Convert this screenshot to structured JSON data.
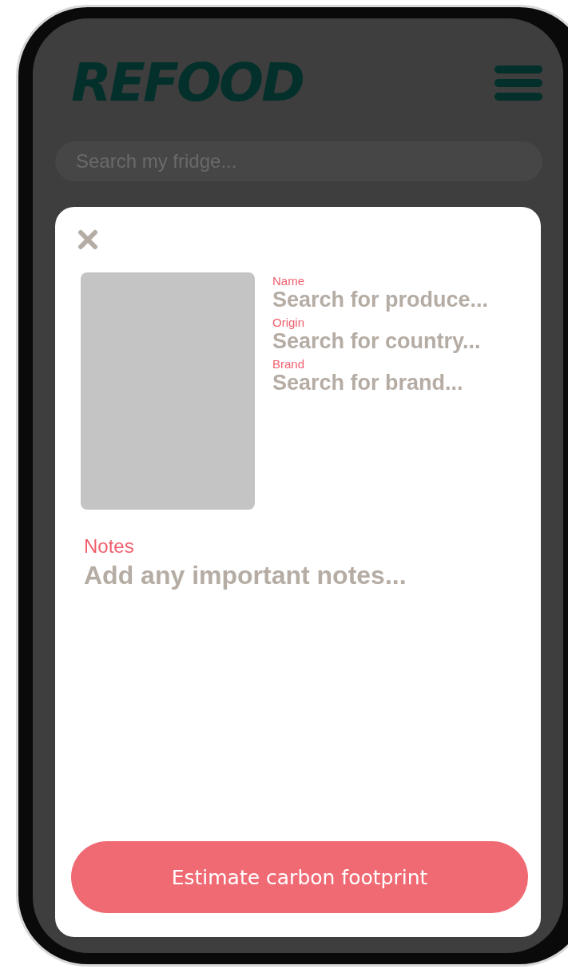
{
  "header": {
    "logo": "REFOOD"
  },
  "search": {
    "placeholder": "Search my fridge..."
  },
  "modal": {
    "fields": [
      {
        "label": "Name",
        "placeholder": "Search for produce..."
      },
      {
        "label": "Origin",
        "placeholder": "Search for country..."
      },
      {
        "label": "Brand",
        "placeholder": "Search for brand..."
      }
    ],
    "notes": {
      "label": "Notes",
      "placeholder": "Add any important notes..."
    },
    "button": "Estimate carbon footprint"
  }
}
